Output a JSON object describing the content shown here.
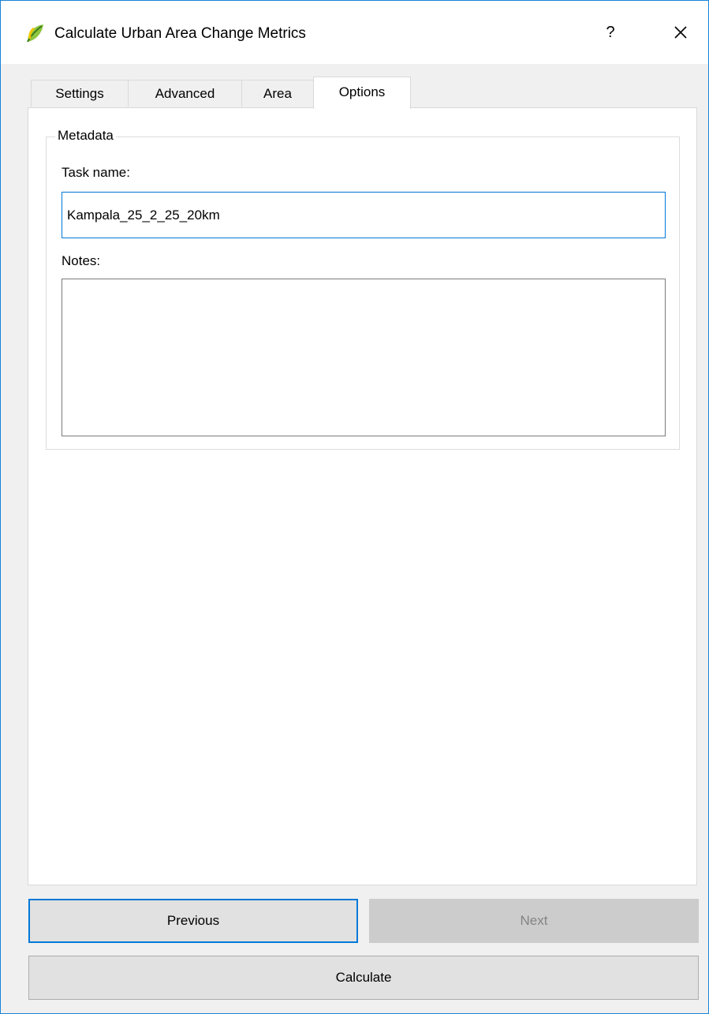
{
  "window": {
    "title": "Calculate Urban Area Change Metrics",
    "help_label": "?",
    "app_icon": "qgis-icon",
    "close_icon": "close-icon",
    "accent_color": "#0078d7"
  },
  "tabs": [
    {
      "label": "Settings",
      "active": false
    },
    {
      "label": "Advanced",
      "active": false
    },
    {
      "label": "Area",
      "active": false
    },
    {
      "label": "Options",
      "active": true
    }
  ],
  "metadata": {
    "group_title": "Metadata",
    "task_name_label": "Task name:",
    "task_name_value": "Kampala_25_2_25_20km",
    "notes_label": "Notes:",
    "notes_value": ""
  },
  "buttons": {
    "previous": "Previous",
    "next": "Next",
    "next_enabled": false,
    "calculate": "Calculate"
  }
}
